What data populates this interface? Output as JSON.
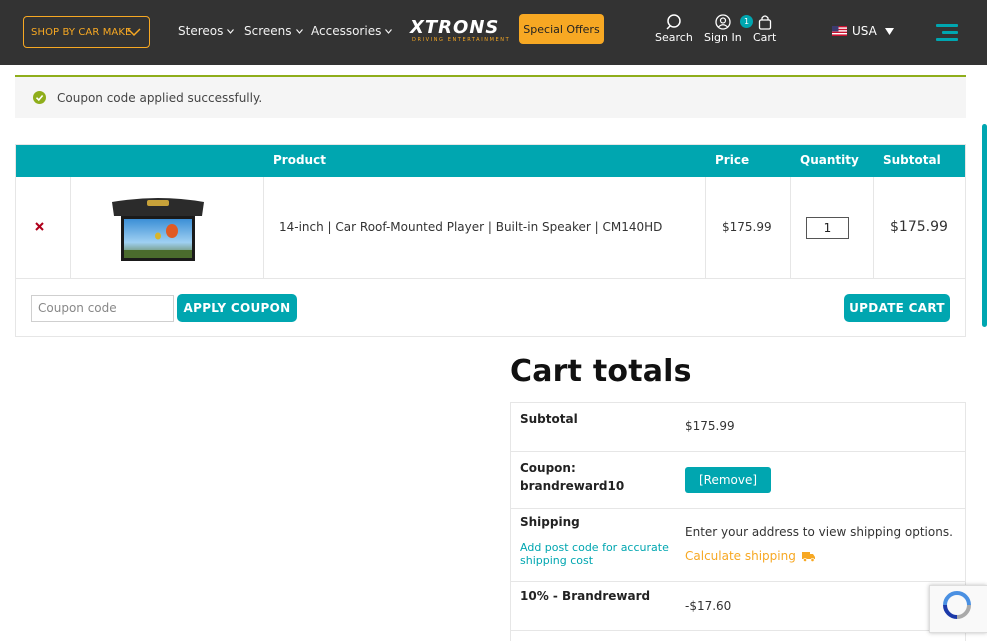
{
  "header": {
    "shop_by_make": "SHOP BY CAR MAKE",
    "nav": [
      "Stereos",
      "Screens",
      "Accessories"
    ],
    "logo_text": "XTRONS",
    "logo_tagline": "DRIVING ENTERTAINMENT",
    "special_offers": "Special Offers",
    "search_label": "Search",
    "signin_label": "Sign In",
    "cart_label": "Cart",
    "cart_count": "1",
    "country": "USA"
  },
  "notice": {
    "message": "Coupon code applied successfully."
  },
  "cart_table": {
    "headers": {
      "product": "Product",
      "price": "Price",
      "quantity": "Quantity",
      "subtotal": "Subtotal"
    },
    "items": [
      {
        "name": "14-inch | Car Roof-Mounted Player | Built-in Speaker | CM140HD",
        "price": "$175.99",
        "quantity": "1",
        "subtotal": "$175.99"
      }
    ],
    "coupon_placeholder": "Coupon code",
    "apply_coupon": "APPLY COUPON",
    "update_cart": "UPDATE CART"
  },
  "totals": {
    "title": "Cart totals",
    "subtotal_label": "Subtotal",
    "subtotal_value": "$175.99",
    "coupon_label_1": "Coupon:",
    "coupon_label_2": "brandreward10",
    "coupon_remove": "[Remove]",
    "shipping_label": "Shipping",
    "shipping_hint": "Add post code for accurate shipping cost",
    "shipping_text": "Enter your address to view shipping options.",
    "calculate_shipping": "Calculate shipping",
    "discount_label": "10% - Brandreward",
    "discount_value": "-$17.60"
  },
  "colors": {
    "header_bg": "#333333",
    "accent_teal": "#00a6b0",
    "accent_orange": "#f7a823",
    "notice_border": "#8fae1b",
    "remove_red": "#b0001b"
  },
  "icons": [
    "chevron-down-icon",
    "search-icon",
    "user-icon",
    "bag-icon",
    "us-flag-icon",
    "menu-icon",
    "check-circle-icon",
    "remove-x-icon",
    "truck-icon",
    "recaptcha-icon"
  ]
}
